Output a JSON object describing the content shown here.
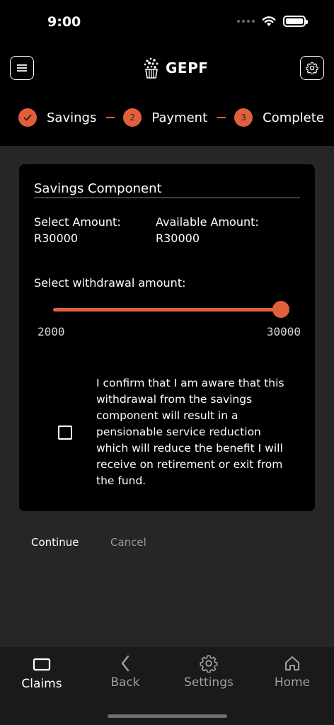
{
  "status_bar": {
    "time": "9:00"
  },
  "header": {
    "brand": "GEPF",
    "menu_icon": "hamburger-icon",
    "settings_icon": "gear-icon"
  },
  "stepper": {
    "steps": [
      {
        "label": "Savings",
        "number": "",
        "state": "done"
      },
      {
        "label": "Payment",
        "number": "2",
        "state": "pending"
      },
      {
        "label": "Complete",
        "number": "3",
        "state": "pending"
      }
    ]
  },
  "card": {
    "title": "Savings Component",
    "select_amount_label": "Select Amount:",
    "select_amount_value": "R30000",
    "available_amount_label": "Available Amount:",
    "available_amount_value": "R30000",
    "slider_label": "Select withdrawal amount:",
    "slider": {
      "min": 2000,
      "max": 30000,
      "value": 30000,
      "min_label": "2000",
      "max_label": "30000"
    },
    "confirm_text": "I confirm that I am aware that this withdrawal from the savings component will result in a pensionable service reduction which will reduce the benefit I will receive on retirement or exit from the fund.",
    "confirm_checked": false
  },
  "actions": {
    "continue_label": "Continue",
    "cancel_label": "Cancel"
  },
  "tabbar": {
    "items": [
      {
        "label": "Claims",
        "icon": "claims-icon"
      },
      {
        "label": "Back",
        "icon": "chevron-left-icon"
      },
      {
        "label": "Settings",
        "icon": "gear-icon"
      },
      {
        "label": "Home",
        "icon": "home-icon"
      }
    ]
  },
  "colors": {
    "accent": "#e0603c",
    "background": "#262626",
    "card": "#000000"
  }
}
